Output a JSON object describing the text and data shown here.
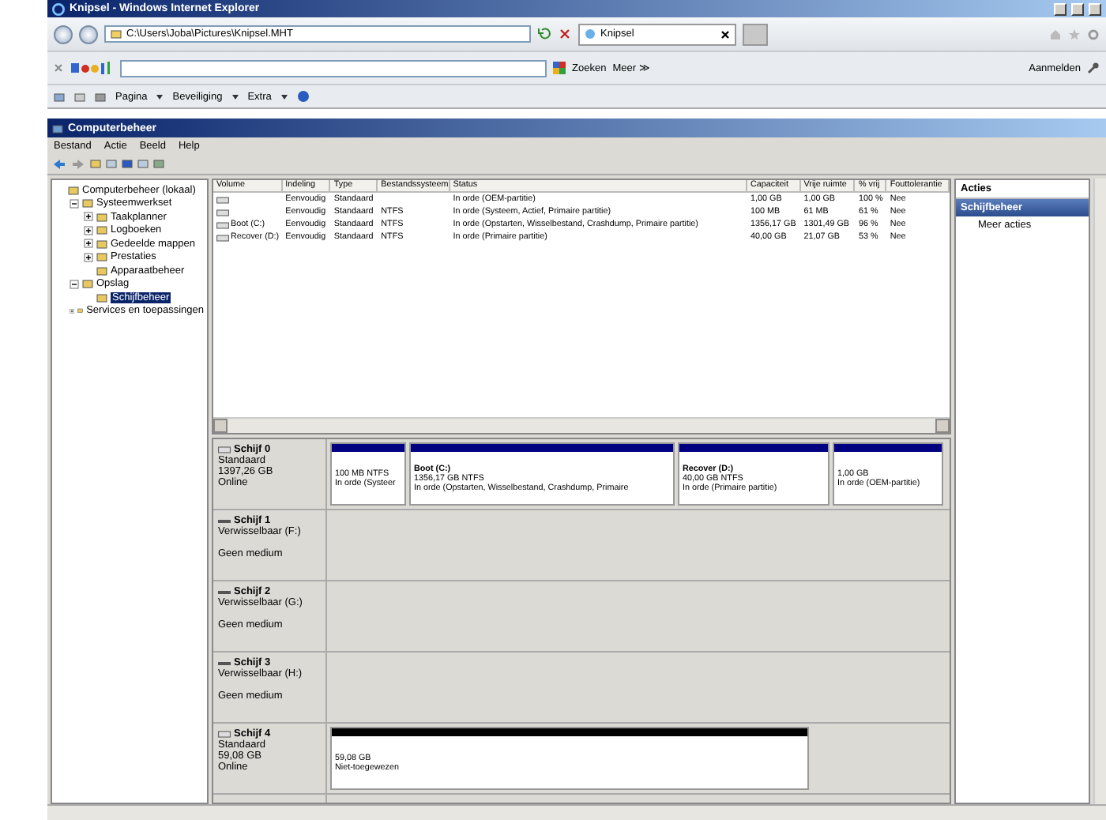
{
  "browser": {
    "title": "Knipsel - Windows Internet Explorer",
    "address": "C:\\Users\\Joba\\Pictures\\Knipsel.MHT",
    "tab_title": "Knipsel",
    "google": {
      "search_button": "Zoeken",
      "more": "Meer ≫",
      "signin": "Aanmelden"
    },
    "command_bar": [
      "Pagina",
      "Beveiliging",
      "Extra"
    ]
  },
  "window": {
    "title": "Computerbeheer"
  },
  "menu": [
    "Bestand",
    "Actie",
    "Beeld",
    "Help"
  ],
  "tree": [
    {
      "label": "Computerbeheer (lokaal)",
      "selected": false,
      "children": [
        {
          "label": "Systeemwerkset",
          "selected": false,
          "expanded": true,
          "children": [
            {
              "label": "Taakplanner",
              "selected": false,
              "expanded": false
            },
            {
              "label": "Logboeken",
              "selected": false,
              "expanded": false
            },
            {
              "label": "Gedeelde mappen",
              "selected": false,
              "expanded": false
            },
            {
              "label": "Prestaties",
              "selected": false,
              "expanded": false
            },
            {
              "label": "Apparaatbeheer",
              "selected": false
            }
          ]
        },
        {
          "label": "Opslag",
          "selected": false,
          "expanded": true,
          "children": [
            {
              "label": "Schijfbeheer",
              "selected": true
            }
          ]
        },
        {
          "label": "Services en toepassingen",
          "selected": false,
          "expanded": false
        }
      ]
    }
  ],
  "table": {
    "columns": [
      "Volume",
      "Indeling",
      "Type",
      "Bestandssysteem",
      "Status",
      "Capaciteit",
      "Vrije ruimte",
      "% vrij",
      "Fouttolerantie"
    ],
    "rows": [
      [
        "",
        "Eenvoudig",
        "Standaard",
        "",
        "In orde (OEM-partitie)",
        "1,00 GB",
        "1,00 GB",
        "100 %",
        "Nee"
      ],
      [
        "",
        "Eenvoudig",
        "Standaard",
        "NTFS",
        "In orde (Systeem, Actief, Primaire partitie)",
        "100 MB",
        "61 MB",
        "61 %",
        "Nee"
      ],
      [
        "Boot (C:)",
        "Eenvoudig",
        "Standaard",
        "NTFS",
        "In orde (Opstarten, Wisselbestand, Crashdump, Primaire partitie)",
        "1356,17 GB",
        "1301,49 GB",
        "96 %",
        "Nee"
      ],
      [
        "Recover (D:)",
        "Eenvoudig",
        "Standaard",
        "NTFS",
        "In orde (Primaire partitie)",
        "40,00 GB",
        "21,07 GB",
        "53 %",
        "Nee"
      ]
    ]
  },
  "disks": [
    {
      "kind": "basic",
      "name": "Schijf 0",
      "lines": [
        "Standaard",
        "1397,26 GB",
        "Online"
      ],
      "partitions": [
        {
          "kind": "primary",
          "lines": [
            "100 MB NTFS",
            "In orde (Systeer"
          ]
        },
        {
          "kind": "primary",
          "title": "Boot  (C:)",
          "lines": [
            "1356,17 GB NTFS",
            "In orde (Opstarten, Wisselbestand, Crashdump, Primaire"
          ]
        },
        {
          "kind": "primary",
          "title": "Recover  (D:)",
          "lines": [
            "40,00 GB NTFS",
            "In orde (Primaire partitie)"
          ]
        },
        {
          "kind": "primary",
          "lines": [
            "1,00 GB",
            "In orde (OEM-partitie)"
          ]
        }
      ]
    },
    {
      "kind": "removable",
      "name": "Schijf 1",
      "lines": [
        "Verwisselbaar (F:)",
        "Geen medium"
      ]
    },
    {
      "kind": "removable",
      "name": "Schijf 2",
      "lines": [
        "Verwisselbaar (G:)",
        "Geen medium"
      ]
    },
    {
      "kind": "removable",
      "name": "Schijf 3",
      "lines": [
        "Verwisselbaar (H:)",
        "Geen medium"
      ]
    },
    {
      "kind": "basic",
      "name": "Schijf 4",
      "lines": [
        "Standaard",
        "59,08 GB",
        "Online"
      ],
      "partitions": [
        {
          "kind": "unallocated",
          "lines": [
            "59,08 GB",
            "Niet-toegewezen"
          ]
        }
      ]
    }
  ],
  "actions": {
    "header": "Acties",
    "section": "Schijfbeheer",
    "items": [
      "Meer acties"
    ]
  }
}
